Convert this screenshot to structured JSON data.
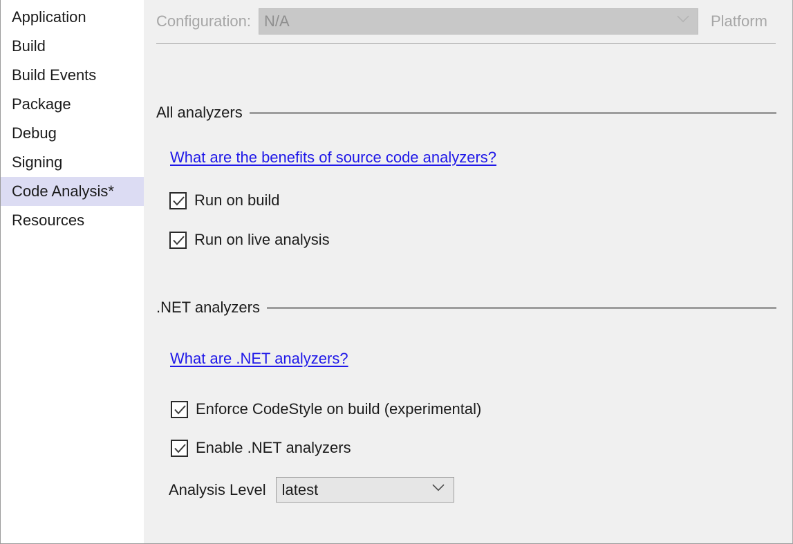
{
  "sidebar": {
    "items": [
      {
        "label": "Application",
        "selected": false
      },
      {
        "label": "Build",
        "selected": false
      },
      {
        "label": "Build Events",
        "selected": false
      },
      {
        "label": "Package",
        "selected": false
      },
      {
        "label": "Debug",
        "selected": false
      },
      {
        "label": "Signing",
        "selected": false
      },
      {
        "label": "Code Analysis*",
        "selected": true
      },
      {
        "label": "Resources",
        "selected": false
      }
    ]
  },
  "config_bar": {
    "configuration_label": "Configuration:",
    "configuration_value": "N/A",
    "configuration_options": [
      "N/A"
    ],
    "platform_label": "Platform"
  },
  "sections": {
    "all_analyzers": {
      "title": "All analyzers",
      "link": "What are the benefits of source code analyzers?",
      "checkboxes": [
        {
          "label": "Run on build",
          "checked": true
        },
        {
          "label": "Run on live analysis",
          "checked": true
        }
      ]
    },
    "net_analyzers": {
      "title": ".NET analyzers",
      "link": "What are .NET analyzers?",
      "checkboxes": [
        {
          "label": "Enforce CodeStyle on build (experimental)",
          "checked": true
        },
        {
          "label": "Enable .NET analyzers",
          "checked": true
        }
      ],
      "analysis_level_label": "Analysis Level",
      "analysis_level_value": "latest",
      "analysis_level_options": [
        "latest"
      ]
    }
  },
  "colors": {
    "selection": "#dcdcf3",
    "link": "#1f18e8",
    "content_bg": "#f0f0f0",
    "sidebar_bg": "#ffffff",
    "disabled_text": "#a6a6a6"
  }
}
